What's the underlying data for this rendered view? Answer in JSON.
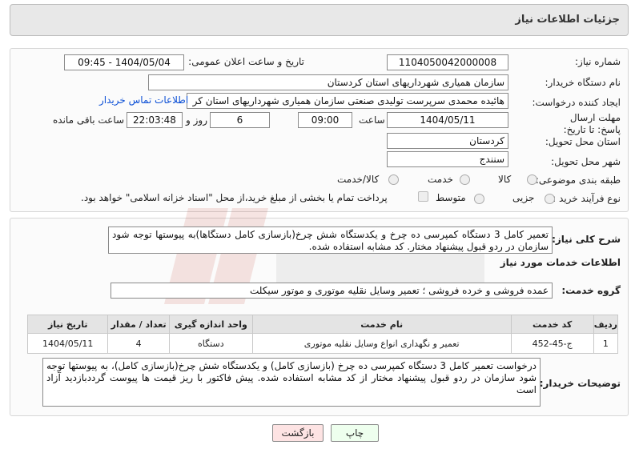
{
  "header": {
    "title": "جزئیات اطلاعات نیاز"
  },
  "form": {
    "need_number_label": "شماره نیاز:",
    "need_number": "1104050042000008",
    "announce_label": "تاریخ و ساعت اعلان عمومی:",
    "announce_value": "1404/05/04 - 09:45",
    "buyer_label": "نام دستگاه خریدار:",
    "buyer_value": "سازمان همیاری شهرداریهای استان کردستان",
    "requester_label": "ایجاد کننده درخواست:",
    "requester_value": "هائیده محمدی سرپرست تولیدی صنعتی سازمان همیاری شهرداریهای استان کر",
    "contact_link": "اطلاعات تماس خریدار",
    "deadline_label": "مهلت ارسال پاسخ: تا تاریخ:",
    "deadline_date": "1404/05/11",
    "time_label": "ساعت",
    "deadline_time": "09:00",
    "days_value": "6",
    "days_label": "روز و",
    "remaining_time": "22:03:48",
    "remaining_label": "ساعت باقی مانده",
    "province_label": "استان محل تحویل:",
    "province_value": "کردستان",
    "city_label": "شهر محل تحویل:",
    "city_value": "سنندج",
    "category_label": "طبقه بندی موضوعی:",
    "category_options": [
      "کالا",
      "خدمت",
      "کالا/خدمت"
    ],
    "process_label": "نوع فرآیند خرید :",
    "process_options": [
      "جزیی",
      "متوسط"
    ],
    "payment_note": "پرداخت تمام یا بخشی از مبلغ خرید،از محل \"اسناد خزانه اسلامی\" خواهد بود."
  },
  "description": {
    "label": "شرح کلی نیاز:",
    "text": "تعمیر کامل 3 دستگاه کمپرسی ده چرخ و یکدستگاه شش چرخ(بازسازی کامل دستگاها)به پیوستها توجه شود سازمان در ردو قبول پیشنهاد مختار. کد مشابه استفاده شده."
  },
  "services": {
    "section_title": "اطلاعات خدمات مورد نیاز",
    "group_label": "گروه خدمت:",
    "group_value": "عمده فروشی و خرده فروشی ؛ تعمیر وسایل نقلیه موتوری و موتور سیکلت",
    "table": {
      "headers": [
        "ردیف",
        "کد خدمت",
        "نام خدمت",
        "واحد اندازه گیری",
        "تعداد / مقدار",
        "تاریخ نیاز"
      ],
      "rows": [
        [
          "1",
          "ج-45-452",
          "تعمیر و نگهداری انواع وسایل نقلیه موتوری",
          "دستگاه",
          "4",
          "1404/05/11"
        ]
      ]
    }
  },
  "buyer_notes": {
    "label": "توضیحات خریدار:",
    "text": "درخواست تعمیر کامل 3 دستگاه کمپرسی ده چرخ (بازسازی کامل) و یکدستگاه شش چرخ(بازسازی کامل)، به پیوستها توجه شود سازمان در ردو قبول پیشنهاد مختار از کد مشابه استفاده شده. پیش فاکتور با ریز قیمت ها پیوست گرددبازدید آزاد است"
  },
  "buttons": {
    "print": "چاپ",
    "back": "بازگشت"
  },
  "colors": {
    "link": "#0b4fd6",
    "back_button_bg": "#fde3e3",
    "print_button_bg": "#eeffee"
  }
}
